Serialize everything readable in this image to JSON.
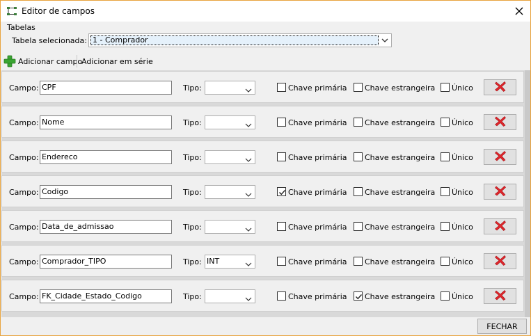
{
  "window": {
    "title": "Editor de campos",
    "accent_border": "#e8a33d",
    "close_icon": "close-icon"
  },
  "tables": {
    "legend": "Tabelas",
    "label": "Tabela selecionada:",
    "selected": "1 - Comprador"
  },
  "toolbar": {
    "add_field_label": "Adicionar campo",
    "add_series_label": "Adicionar em série"
  },
  "row_labels": {
    "field": "Campo:",
    "type": "Tipo:",
    "primary_key": "Chave primária",
    "foreign_key": "Chave estrangeira",
    "unique": "Único"
  },
  "fields": [
    {
      "name": "CPF",
      "type": "",
      "primary_key": false,
      "foreign_key": false,
      "unique": false
    },
    {
      "name": "Nome",
      "type": "",
      "primary_key": false,
      "foreign_key": false,
      "unique": false
    },
    {
      "name": "Endereco",
      "type": "",
      "primary_key": false,
      "foreign_key": false,
      "unique": false
    },
    {
      "name": "Codigo",
      "type": "",
      "primary_key": true,
      "foreign_key": false,
      "unique": false
    },
    {
      "name": "Data_de_admissao",
      "type": "",
      "primary_key": false,
      "foreign_key": false,
      "unique": false
    },
    {
      "name": "Comprador_TIPO",
      "type": "INT",
      "primary_key": false,
      "foreign_key": false,
      "unique": false
    },
    {
      "name": "FK_Cidade_Estado_Codigo",
      "type": "",
      "primary_key": false,
      "foreign_key": true,
      "unique": false
    }
  ],
  "footer": {
    "close_label": "FECHAR"
  },
  "colors": {
    "delete_icon": "#e0262c",
    "add_icon": "#3aa532"
  }
}
